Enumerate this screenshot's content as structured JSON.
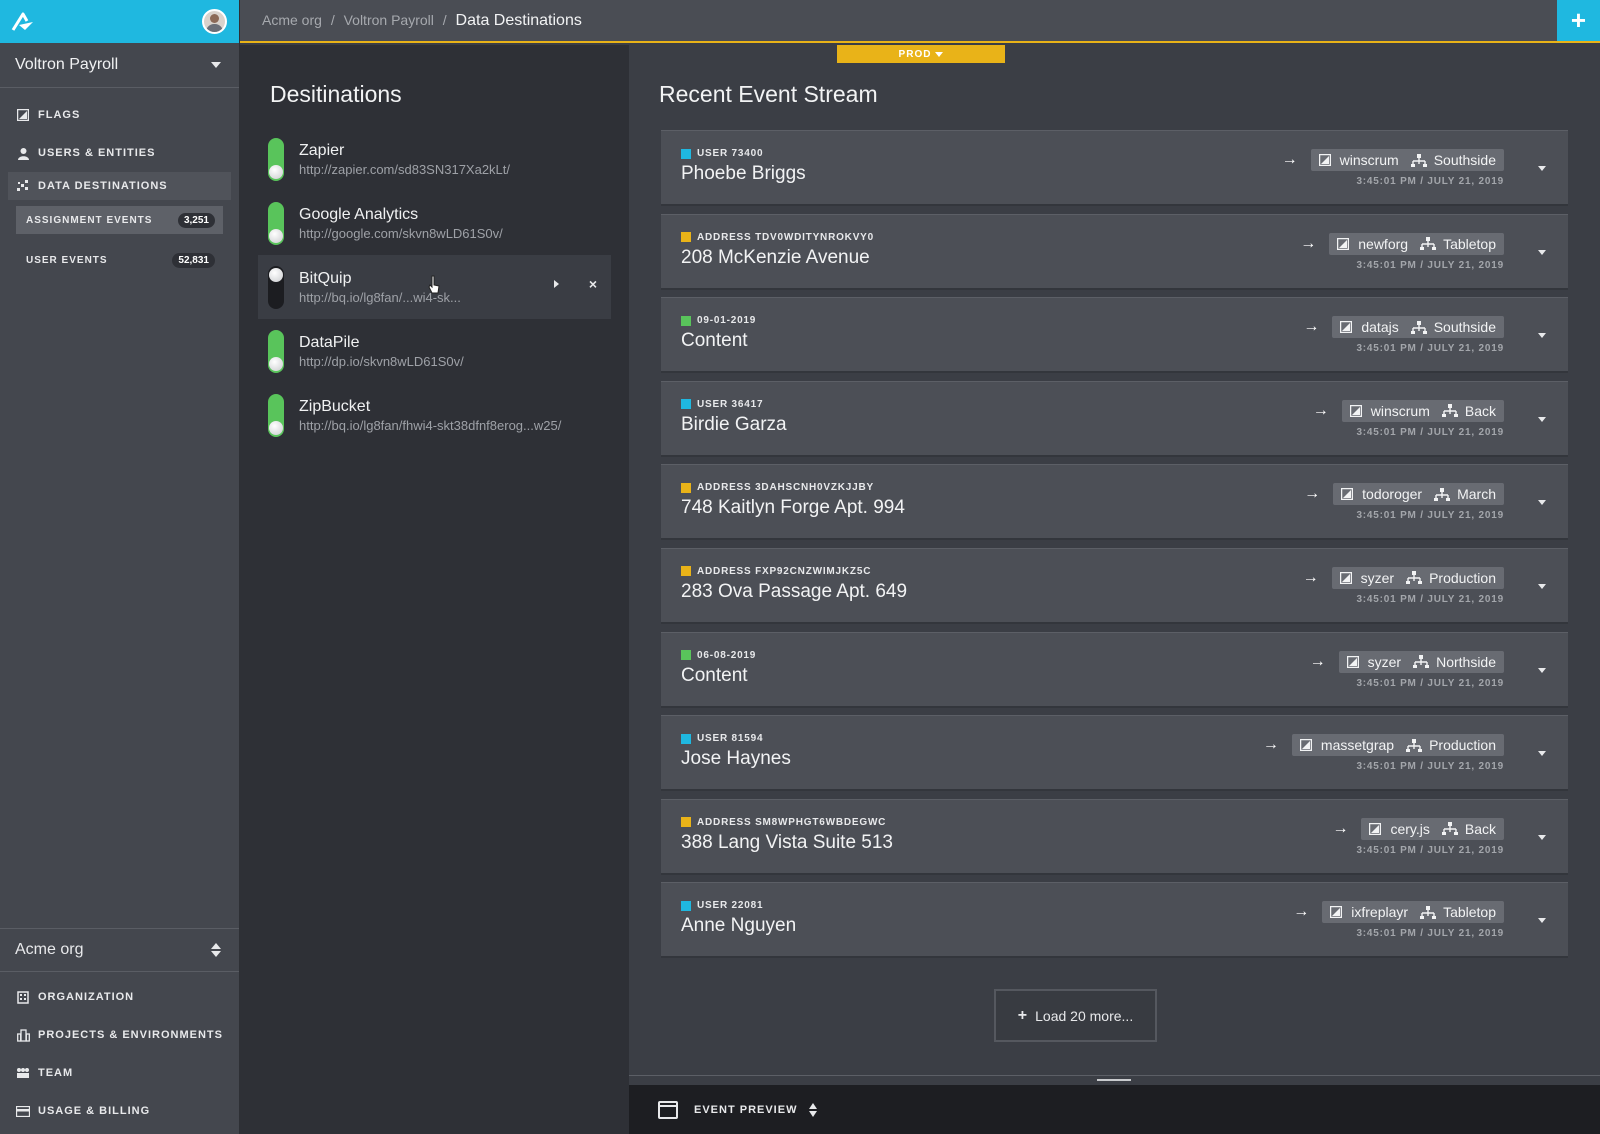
{
  "sidebar": {
    "project": "Voltron Payroll",
    "nav": [
      {
        "label": "FLAGS",
        "icon": "flag-icon"
      },
      {
        "label": "USERS & ENTITIES",
        "icon": "user-icon"
      },
      {
        "label": "DATA DESTINATIONS",
        "icon": "scatter-icon"
      }
    ],
    "sub": [
      {
        "label": "ASSIGNMENT EVENTS",
        "count": "3,251"
      },
      {
        "label": "USER EVENTS",
        "count": "52,831"
      }
    ],
    "org": "Acme org",
    "bottom_nav": [
      {
        "label": "ORGANIZATION",
        "icon": "building-icon"
      },
      {
        "label": "PROJECTS & ENVIRONMENTS",
        "icon": "projects-icon"
      },
      {
        "label": "TEAM",
        "icon": "team-icon"
      },
      {
        "label": "USAGE & BILLING",
        "icon": "card-icon"
      }
    ]
  },
  "topbar": {
    "crumbs": [
      "Acme org",
      "Voltron Payroll"
    ],
    "separator": "/",
    "current": "Data Destinations",
    "add": "+",
    "env": "PROD"
  },
  "destinations": {
    "title": "Desitinations",
    "items": [
      {
        "name": "Zapier",
        "url": "http://zapier.com/sd83SN317Xa2kLt/",
        "enabled": true
      },
      {
        "name": "Google Analytics",
        "url": "http://google.com/skvn8wLD61S0v/",
        "enabled": true
      },
      {
        "name": "BitQuip",
        "url": "http://bq.io/lg8fan/...wi4-sk...",
        "enabled": false
      },
      {
        "name": "DataPile",
        "url": "http://dp.io/skvn8wLD61S0v/",
        "enabled": true
      },
      {
        "name": "ZipBucket",
        "url": "http://bq.io/lg8fan/fhwi4-skt38dfnf8erog...w25/",
        "enabled": true
      }
    ]
  },
  "stream": {
    "title": "Recent Event Stream",
    "events": [
      {
        "kind": "user",
        "label": "USER 73400",
        "title": "Phoebe Briggs",
        "flag": "winscrum",
        "env": "Southside",
        "time": "3:45:01 PM / JULY 21, 2019"
      },
      {
        "kind": "address",
        "label": "ADDRESS TDV0WDITYNROKVY0",
        "title": "208 McKenzie Avenue",
        "flag": "newforg",
        "env": "Tabletop",
        "time": "3:45:01 PM / JULY 21, 2019"
      },
      {
        "kind": "date",
        "label": "09-01-2019",
        "title": "Content",
        "flag": "datajs",
        "env": "Southside",
        "time": "3:45:01 PM / JULY 21, 2019"
      },
      {
        "kind": "user",
        "label": "USER 36417",
        "title": "Birdie Garza",
        "flag": "winscrum",
        "env": "Back",
        "time": "3:45:01 PM / JULY 21, 2019"
      },
      {
        "kind": "address",
        "label": "ADDRESS 3DAHSCNH0VZKJJBY",
        "title": "748 Kaitlyn Forge Apt. 994",
        "flag": "todoroger",
        "env": "March",
        "time": "3:45:01 PM / JULY 21, 2019"
      },
      {
        "kind": "address",
        "label": "ADDRESS FXP92CNZWIMJKZ5C",
        "title": "283 Ova Passage Apt. 649",
        "flag": "syzer",
        "env": "Production",
        "time": "3:45:01 PM / JULY 21, 2019"
      },
      {
        "kind": "date",
        "label": "06-08-2019",
        "title": "Content",
        "flag": "syzer",
        "env": "Northside",
        "time": "3:45:01 PM / JULY 21, 2019"
      },
      {
        "kind": "user",
        "label": "USER 81594",
        "title": "Jose Haynes",
        "flag": "massetgrap",
        "env": "Production",
        "time": "3:45:01 PM / JULY 21, 2019"
      },
      {
        "kind": "address",
        "label": "ADDRESS SM8WPHGT6WBDEGWC",
        "title": "388 Lang Vista Suite 513",
        "flag": "cery.js",
        "env": "Back",
        "time": "3:45:01 PM / JULY 21, 2019"
      },
      {
        "kind": "user",
        "label": "USER 22081",
        "title": "Anne Nguyen",
        "flag": "ixfreplayr",
        "env": "Tabletop",
        "time": "3:45:01 PM / JULY 21, 2019"
      }
    ],
    "load_more": "Load 20 more..."
  },
  "preview": {
    "label": "EVENT PREVIEW"
  },
  "colors": {
    "accent": "#1fb8e0",
    "prod": "#e9b318",
    "enabled": "#59c45b"
  }
}
